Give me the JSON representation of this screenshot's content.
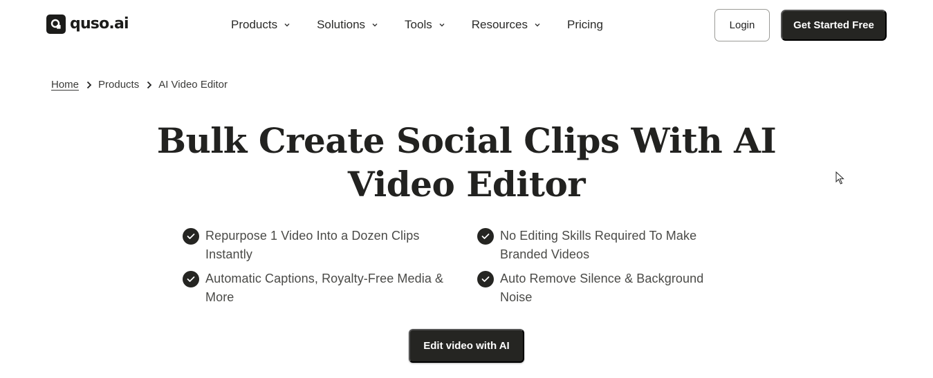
{
  "brand": {
    "name": "quso.ai",
    "logo_icon": "q-logo-icon"
  },
  "nav": {
    "items": [
      {
        "label": "Products",
        "has_dropdown": true
      },
      {
        "label": "Solutions",
        "has_dropdown": true
      },
      {
        "label": "Tools",
        "has_dropdown": true
      },
      {
        "label": "Resources",
        "has_dropdown": true
      },
      {
        "label": "Pricing",
        "has_dropdown": false
      }
    ],
    "login_label": "Login",
    "get_started_label": "Get Started Free"
  },
  "breadcrumb": [
    {
      "label": "Home"
    },
    {
      "label": "Products"
    },
    {
      "label": "AI Video Editor"
    }
  ],
  "hero": {
    "title": "Bulk Create Social Clips With AI Video Editor",
    "features": [
      {
        "text": "Repurpose 1 Video Into a Dozen Clips Instantly",
        "icon": "check-circle-icon"
      },
      {
        "text": "No Editing Skills Required To Make Branded Videos",
        "icon": "check-circle-icon"
      },
      {
        "text": "Automatic Captions, Royalty-Free Media & More",
        "icon": "check-circle-icon"
      },
      {
        "text": "Auto Remove Silence & Background Noise",
        "icon": "check-circle-icon"
      }
    ],
    "cta_label": "Edit video with AI"
  },
  "colors": {
    "primary": "#252522",
    "text": "#222220",
    "muted_text": "#4a4a47",
    "background": "#ffffff"
  }
}
